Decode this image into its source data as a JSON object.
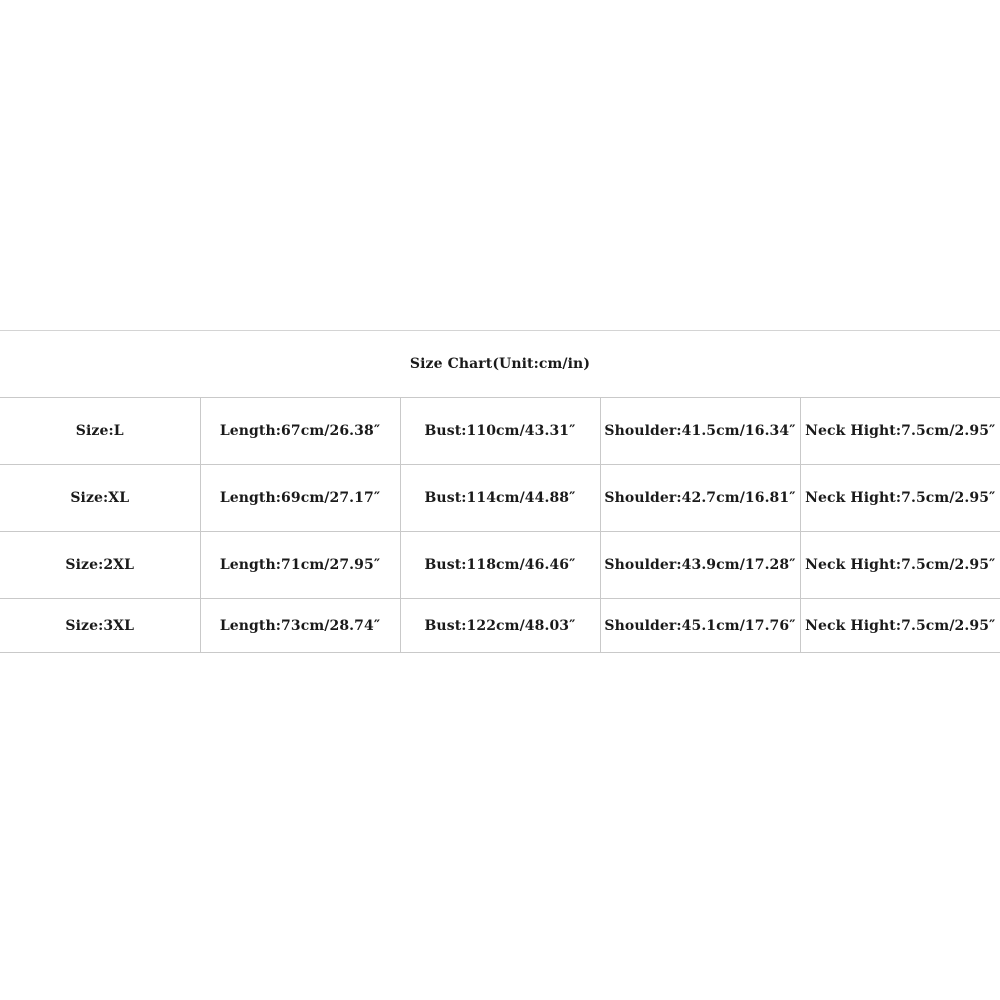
{
  "size_chart": {
    "title": "Size Chart(Unit:cm/in)",
    "rows": [
      {
        "size": "Size:L",
        "length": "Length:67cm/26.38″",
        "bust": "Bust:110cm/43.31″",
        "shoulder": "Shoulder:41.5cm/16.34″",
        "neck": "Neck Hight:7.5cm/2.95″"
      },
      {
        "size": "Size:XL",
        "length": "Length:69cm/27.17″",
        "bust": "Bust:114cm/44.88″",
        "shoulder": "Shoulder:42.7cm/16.81″",
        "neck": "Neck Hight:7.5cm/2.95″"
      },
      {
        "size": "Size:2XL",
        "length": "Length:71cm/27.95″",
        "bust": "Bust:118cm/46.46″",
        "shoulder": "Shoulder:43.9cm/17.28″",
        "neck": "Neck Hight:7.5cm/2.95″"
      },
      {
        "size": "Size:3XL",
        "length": "Length:73cm/28.74″",
        "bust": "Bust:122cm/48.03″",
        "shoulder": "Shoulder:45.1cm/17.76″",
        "neck": "Neck Hight:7.5cm/2.95″"
      }
    ]
  }
}
